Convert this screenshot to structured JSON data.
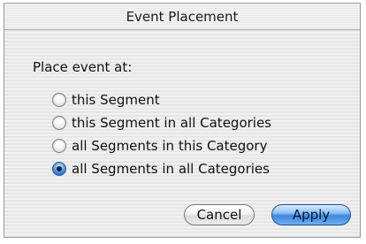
{
  "window": {
    "title": "Event Placement"
  },
  "dialog": {
    "prompt": "Place event at:",
    "options": [
      {
        "label": "this Segment",
        "selected": false
      },
      {
        "label": "this Segment in all Categories",
        "selected": false
      },
      {
        "label": "all Segments in this Category",
        "selected": false
      },
      {
        "label": "all Segments in all Categories",
        "selected": true
      }
    ]
  },
  "buttons": {
    "cancel_label": "Cancel",
    "apply_label": "Apply"
  },
  "colors": {
    "accent": "#3d86dd",
    "window_bg": "#ececec"
  }
}
